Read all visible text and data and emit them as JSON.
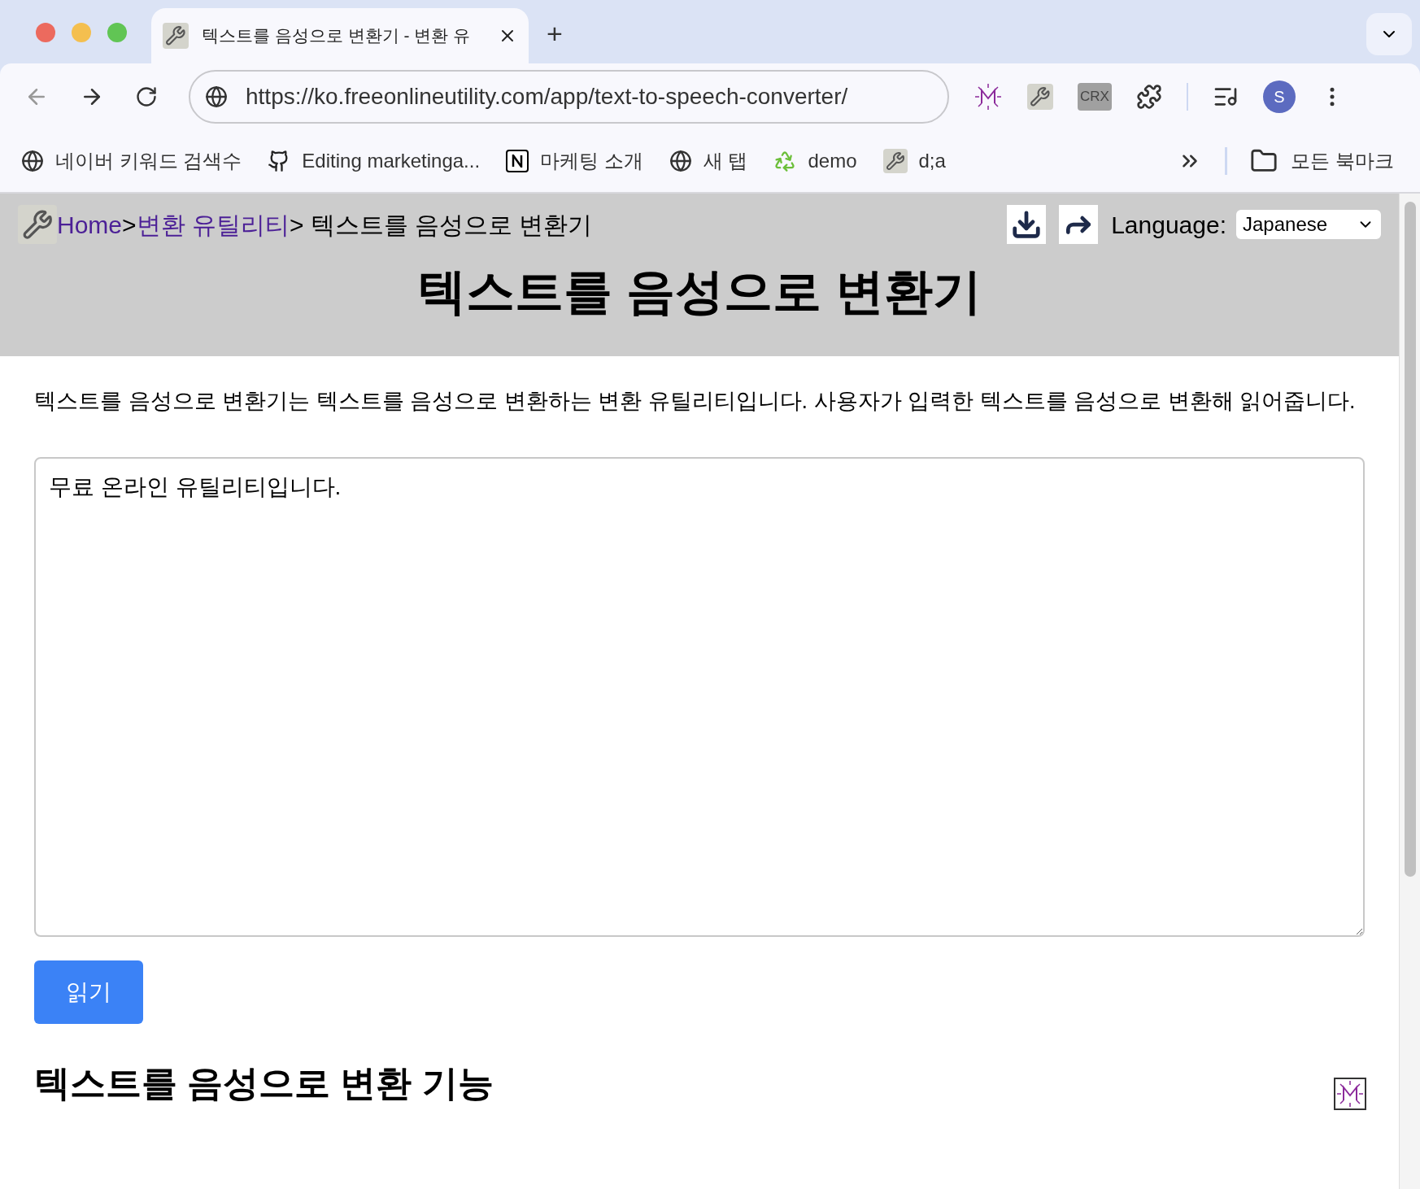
{
  "browser": {
    "tab": {
      "title": "텍스트를 음성으로 변환기 - 변환 유",
      "selected": true
    },
    "new_tab": "+",
    "url": "https://ko.freeonlineutility.com/app/text-to-speech-converter/",
    "profile_initial": "S",
    "extension_label": "CRX",
    "bookmarks": [
      {
        "kind": "globe",
        "label": "네이버 키워드 검색수"
      },
      {
        "kind": "github",
        "label": "Editing marketinga..."
      },
      {
        "kind": "notion",
        "label": "마케팅 소개"
      },
      {
        "kind": "globe",
        "label": "새 탭"
      },
      {
        "kind": "recycle",
        "label": "demo"
      },
      {
        "kind": "wrench",
        "label": "d;a"
      }
    ],
    "all_bookmarks": "모든 북마크"
  },
  "page": {
    "breadcrumb": [
      {
        "label": "Home",
        "link": true
      },
      {
        "label": ">",
        "link": false
      },
      {
        "label": "변환 유틸리티",
        "link": true
      },
      {
        "label": "> 텍스트를 음성으로 변환기",
        "link": false
      }
    ],
    "language_label": "Language:",
    "language": "Japanese",
    "title": "텍스트를 음성으로 변환기",
    "description": "텍스트를 음성으로 변환기는 텍스트를 음성으로 변환하는 변환 유틸리티입니다. 사용자가 입력한 텍스트를 음성으로 변환해 읽어줍니다.",
    "text_input": "무료 온라인 유틸리티입니다.",
    "read_button": "읽기",
    "section_heading": "텍스트를 음성으로 변환 기능"
  }
}
